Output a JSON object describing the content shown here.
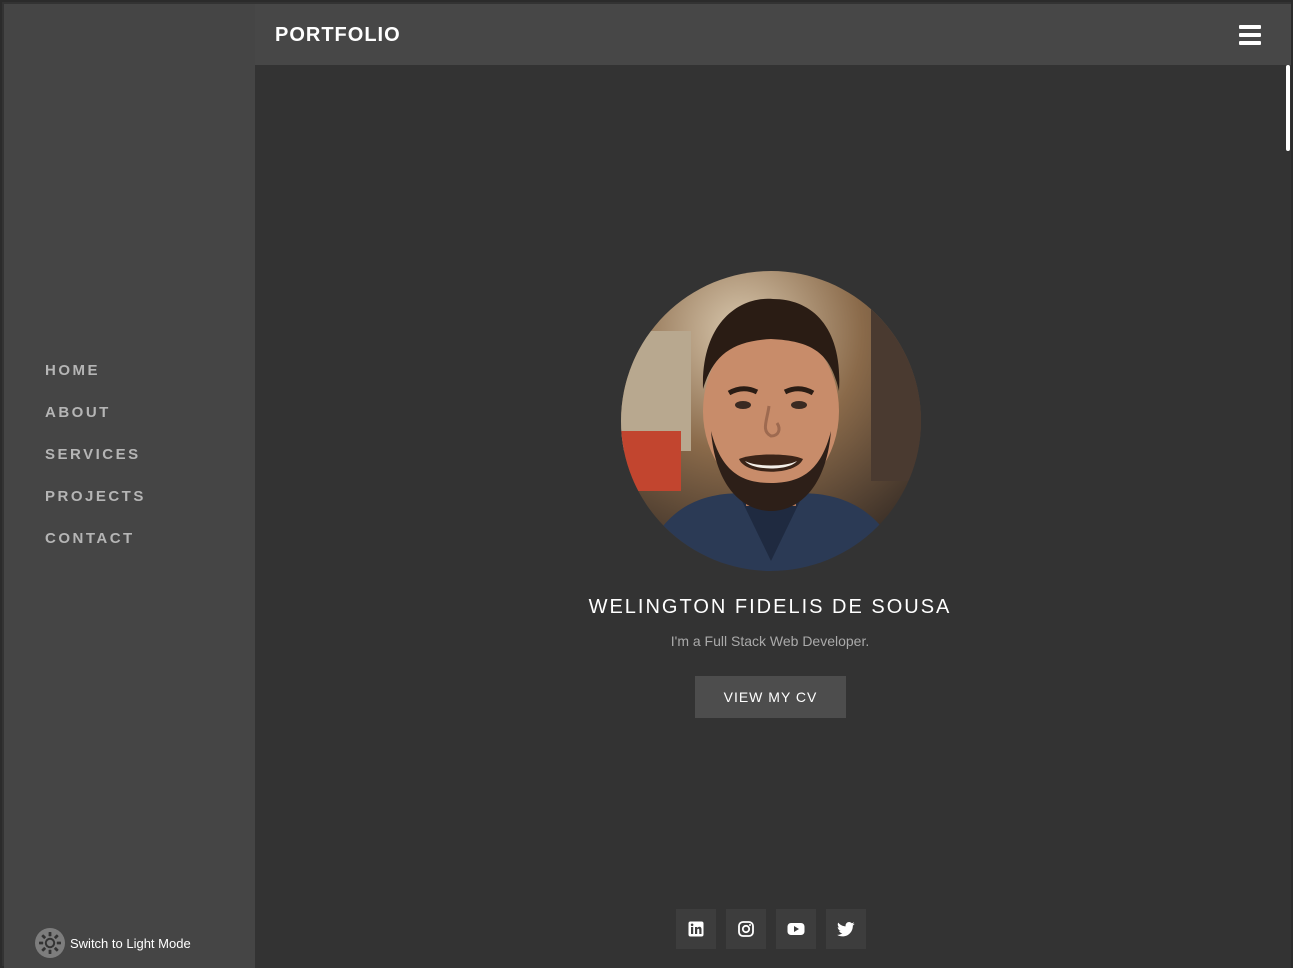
{
  "header": {
    "brand": "PORTFOLIO",
    "menu_icon": "hamburger-menu-icon"
  },
  "sidebar": {
    "items": [
      {
        "label": "HOME"
      },
      {
        "label": "ABOUT"
      },
      {
        "label": "SERVICES"
      },
      {
        "label": "PROJECTS"
      },
      {
        "label": "CONTACT"
      }
    ],
    "mode_toggle": {
      "icon": "sun-icon",
      "label": "Switch to Light Mode"
    }
  },
  "hero": {
    "avatar": "profile-photo",
    "name": "WELINGTON FIDELIS DE SOUSA",
    "tagline": "I'm a Full Stack Web Developer.",
    "cv_button": "VIEW MY CV"
  },
  "socials": [
    {
      "icon": "linkedin-icon"
    },
    {
      "icon": "instagram-icon"
    },
    {
      "icon": "youtube-icon"
    },
    {
      "icon": "twitter-icon"
    }
  ],
  "colors": {
    "background": "#333333",
    "sidebar": "#454545",
    "topbar": "#474747",
    "nav_text": "#b5b5b5",
    "button": "#4d4d4d",
    "social_button": "#3d3d3d"
  }
}
